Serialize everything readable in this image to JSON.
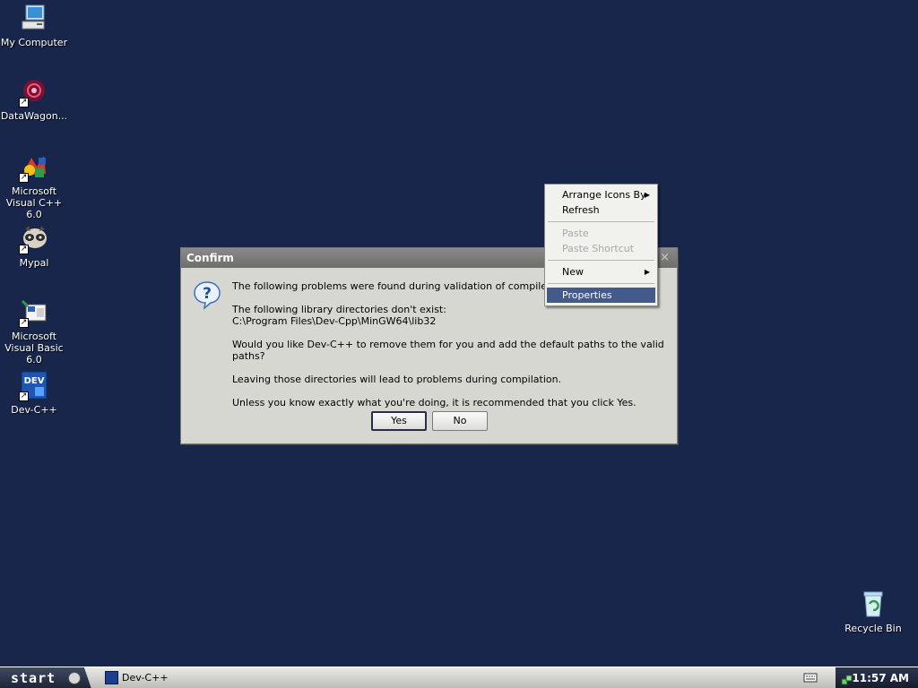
{
  "desktop": {
    "icons": [
      {
        "label": "My Computer",
        "icon": "my-computer-icon"
      },
      {
        "label": "DataWagon...",
        "icon": "datawagon-icon"
      },
      {
        "label": "Microsoft Visual C++ 6.0",
        "icon": "visual-cpp-icon"
      },
      {
        "label": "Mypal",
        "icon": "mypal-icon"
      },
      {
        "label": "Microsoft Visual Basic 6.0",
        "icon": "visual-basic-icon"
      },
      {
        "label": "Dev-C++",
        "icon": "dev-cpp-icon"
      },
      {
        "label": "Recycle Bin",
        "icon": "recycle-bin-icon"
      }
    ],
    "background_color": "#17264a"
  },
  "dialog": {
    "title": "Confirm",
    "close_glyph": "×",
    "icon": "question-icon",
    "line1": "The following problems were found during validation of compiler set \"TDM",
    "line1_tail": "\":",
    "line2a": "The following library directories don't exist:",
    "line2b": "C:\\Program Files\\Dev-Cpp\\MinGW64\\lib32",
    "line3": "Would you like Dev-C++ to remove them for you and add the default paths to the valid paths?",
    "line4": "Leaving those directories will lead to problems during compilation.",
    "line5": "Unless you know exactly what you're doing, it is recommended that you click Yes.",
    "yes_label": "Yes",
    "no_label": "No"
  },
  "context_menu": {
    "arrange_icons": "Arrange Icons By",
    "refresh": "Refresh",
    "paste": "Paste",
    "paste_shortcut": "Paste Shortcut",
    "new": "New",
    "properties": "Properties",
    "submenu_arrow": "▶",
    "highlight_color": "#445a8a"
  },
  "taskbar": {
    "start_label": "start",
    "task_label": "Dev-C++",
    "clock": "11:57 AM"
  }
}
